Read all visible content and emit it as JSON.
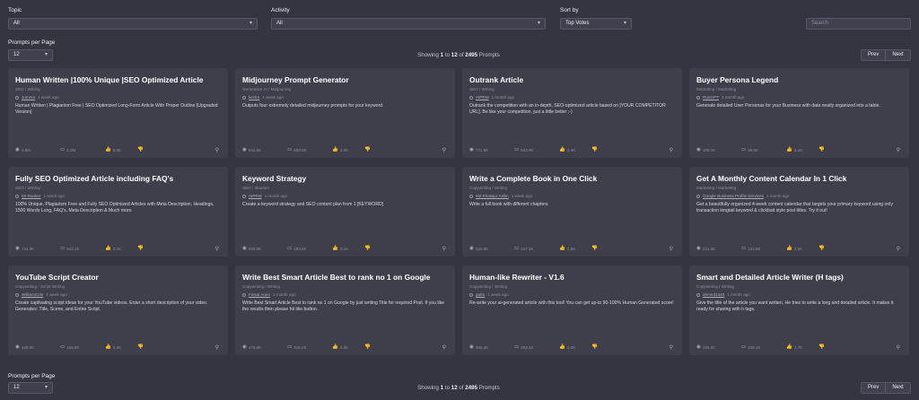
{
  "filters": {
    "topic": {
      "label": "Topic",
      "value": "All"
    },
    "activity": {
      "label": "Activity",
      "value": "All"
    },
    "sort": {
      "label": "Sort by",
      "value": "Top Votes"
    },
    "search_placeholder": "Search"
  },
  "pagination": {
    "per_page_label": "Prompts per Page",
    "per_page_value": "12",
    "showing_prefix": "Showing",
    "from": "1",
    "to_word": "to",
    "to": "12",
    "of_word": "of",
    "total": "2495",
    "suffix": "Prompts",
    "prev": "Prev",
    "next": "Next"
  },
  "cards": [
    {
      "title": "Human Written |100% Unique |SEO Optimized Article",
      "category": "SEO / Writing",
      "author": "Jumma",
      "time": "1 week ago",
      "description": "Human Written | Plagiarism Free | SEO Optimized Long-Form Article With Proper Outline [Upgraded Version]",
      "views": "1.8M",
      "uses": "1.0M",
      "votes": "6.0K"
    },
    {
      "title": "Midjourney Prompt Generator",
      "category": "Generative AI / Midjourney",
      "author": "kenkn",
      "time": "1 week ago",
      "description": "Outputs four extremely detailed midjourney prompts for your keyword.",
      "views": "941.5K",
      "uses": "603.8K",
      "votes": "4.0K"
    },
    {
      "title": "Outrank Article",
      "category": "SEO / Writing",
      "author": "AIPRM",
      "time": "1 month ago",
      "description": "Outrank the competition with an in-depth, SEO-optimized article based on [YOUR COMPETITOR URL]. Be like your competition, just a little better ;-)",
      "views": "771.8K",
      "uses": "543.9K",
      "votes": "1.4K"
    },
    {
      "title": "Buyer Persona Legend",
      "category": "Marketing / Marketing",
      "author": "RonGPT",
      "time": "1 month ago",
      "description": "Generate detailed User Personas for your Business with data neatly organized into a table.",
      "views": "109.1K",
      "uses": "35.5K",
      "votes": "3.2K"
    },
    {
      "title": "Fully SEO Optimized Article including FAQ's",
      "category": "SEO / Writing",
      "author": "Mr Ranker",
      "time": "1 week ago",
      "description": "100% Unique, Plagiarism Free and Fully SEO Optimized Articles with Meta Description, Headings, 1500 Words Long, FAQ's, Meta Description & Much more.",
      "views": "724.8K",
      "uses": "542.1K",
      "votes": "3.1K"
    },
    {
      "title": "Keyword Strategy",
      "category": "SEO / Ideation",
      "author": "AIPRM",
      "time": "1 month ago",
      "description": "Create a keyword strategy and SEO content plan from 1 [KEYWORD]",
      "views": "835.8K",
      "uses": "483.8K",
      "votes": "3.1K"
    },
    {
      "title": "Write a Complete Book in One Click",
      "category": "Copywriting / Writing",
      "author": "Md Khaliqur Aslim",
      "time": "1 week ago",
      "description": "Write a full book with different chapters",
      "views": "340.8K",
      "uses": "217.2K",
      "votes": "2.5K"
    },
    {
      "title": "Get A Monthly Content Calendar In 1 Click",
      "category": "Marketing / Marketing",
      "author": "Google Business Profile Services",
      "time": "1 month ago",
      "description": "Get a beautifully organized 4-week content calendar that targets your primary keyword using only transaction longtail keyword & clickbait style post titles. Try it out!",
      "views": "241.0K",
      "uses": "142.8K",
      "votes": "2.5K"
    },
    {
      "title": "YouTube Script Creator",
      "category": "Copywriting / Script Writing",
      "author": "WilliamCole",
      "time": "1 week ago",
      "description": "Create captivating script ideas for your YouTube videos. Enter a short description of your video. Generates: Title, Scene, and Entire Script.",
      "views": "328.0K",
      "uses": "165.8K",
      "votes": "2.3K"
    },
    {
      "title": "Write Best Smart Article Best to rank no 1 on Google",
      "category": "Copywriting / Writing",
      "author": "Faisal Arain",
      "time": "1 month ago",
      "description": "Write Best Smart Article Best to rank no 1 on Google by just writing Title for required Post. If you like the results then please hit like button.",
      "views": "478.8K",
      "uses": "318.2K",
      "votes": "2.2K"
    },
    {
      "title": "Human-like Rewriter - V1.6",
      "category": "Copywriting / Writing",
      "author": "gatto",
      "time": "1 week ago",
      "description": "Re-write your ai-generated article with this tool! You can get up-to 90-100% Human Generated score!",
      "views": "355.4K",
      "uses": "253.4K",
      "votes": "2.2K"
    },
    {
      "title": "Smart and Detailed Article Writer (H tags)",
      "category": "Copywriting / Writing",
      "author": "ahmed1340",
      "time": "1 month ago",
      "description": "Give the title of the article you want written. He tries to write a long and detailed article. It makes it ready for sharing with h tags.",
      "views": "328.5K",
      "uses": "228.1K",
      "votes": "1.7K"
    }
  ],
  "icons": {
    "chevron": "chevron-down-icon",
    "views": "eye-icon",
    "uses": "chat-icon",
    "votes": "thumbs-up-icon",
    "downvote": "thumbs-down-icon",
    "link": "paperclip-icon",
    "avatar": "user-avatar-icon"
  }
}
